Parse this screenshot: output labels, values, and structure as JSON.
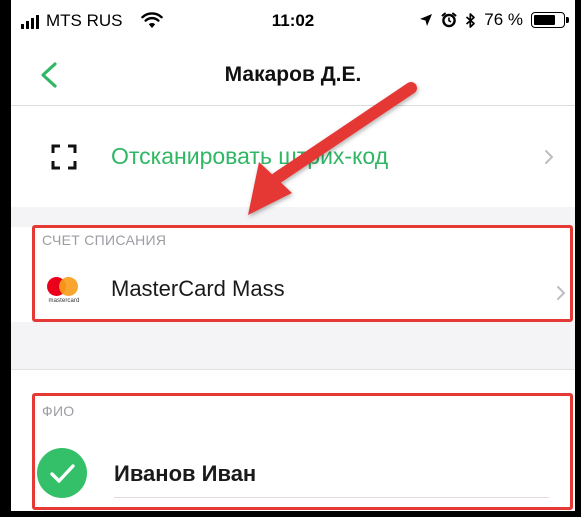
{
  "status_bar": {
    "carrier": "MTS RUS",
    "time": "11:02",
    "battery_percent": "76 %",
    "battery_level": 0.76
  },
  "nav": {
    "title": "Макаров Д.Е."
  },
  "scan": {
    "label": "Отсканировать штрих-код"
  },
  "account": {
    "caption": "СЧЕТ СПИСАНИЯ",
    "card_brand_text": "mastercard",
    "card_name": "MasterCard Mass"
  },
  "name_section": {
    "caption": "ФИО",
    "value": "Иванов Иван"
  },
  "colors": {
    "accent_green": "#2fb764",
    "highlight_red": "#e53935",
    "mastercard_red": "#eb001b",
    "mastercard_orange": "#f79e1b"
  },
  "icons": {
    "back": "chevron-left-icon",
    "scan": "scan-frame-icon",
    "chevron": "chevron-right-icon",
    "check": "checkmark-icon",
    "signal": "cellular-signal-icon",
    "wifi": "wifi-icon",
    "location": "location-arrow-icon",
    "alarm": "alarm-icon",
    "bluetooth": "bluetooth-icon",
    "battery": "battery-icon"
  }
}
